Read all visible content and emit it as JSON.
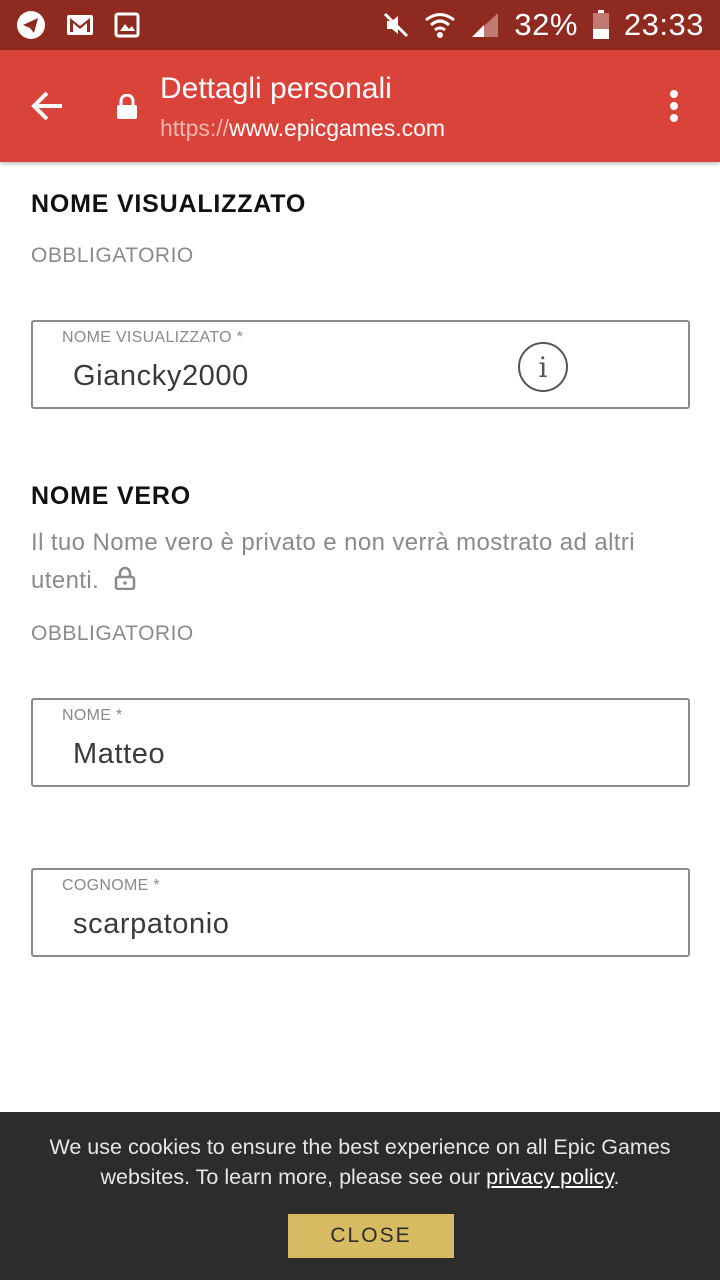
{
  "status_bar": {
    "battery_percent": "32%",
    "time": "23:33",
    "left_icons": [
      "telegram-icon",
      "gmail-icon",
      "gallery-icon"
    ],
    "right_icons": [
      "mute-icon",
      "wifi-icon",
      "signal-icon",
      "battery-icon"
    ]
  },
  "app_bar": {
    "title": "Dettagli personali",
    "url_scheme": "https://",
    "url_host": "www.epicgames.com",
    "icons": [
      "back-arrow-icon",
      "lock-icon",
      "overflow-menu-icon"
    ]
  },
  "display_name_section": {
    "title": "NOME VISUALIZZATO",
    "required": "OBBLIGATORIO",
    "field_label": "NOME VISUALIZZATO *",
    "field_value": "Giancky2000",
    "info_glyph": "i"
  },
  "real_name_section": {
    "title": "NOME VERO",
    "description": "Il tuo Nome vero è privato e non verrà mostrato ad altri utenti.",
    "required": "OBBLIGATORIO",
    "first_name_label": "NOME *",
    "first_name_value": "Matteo",
    "last_name_label": "COGNOME *",
    "last_name_value": "scarpatonio"
  },
  "cookie_banner": {
    "text_before": "We use cookies to ensure the best experience on all Epic Games websites. To learn more, please see our ",
    "link_text": "privacy policy",
    "text_after": ".",
    "close_label": "CLOSE"
  },
  "colors": {
    "status_bar": "#8e2a20",
    "app_bar": "#d9433a",
    "cookie_bg": "#2c2c2c",
    "close_button": "#d6bb62"
  }
}
